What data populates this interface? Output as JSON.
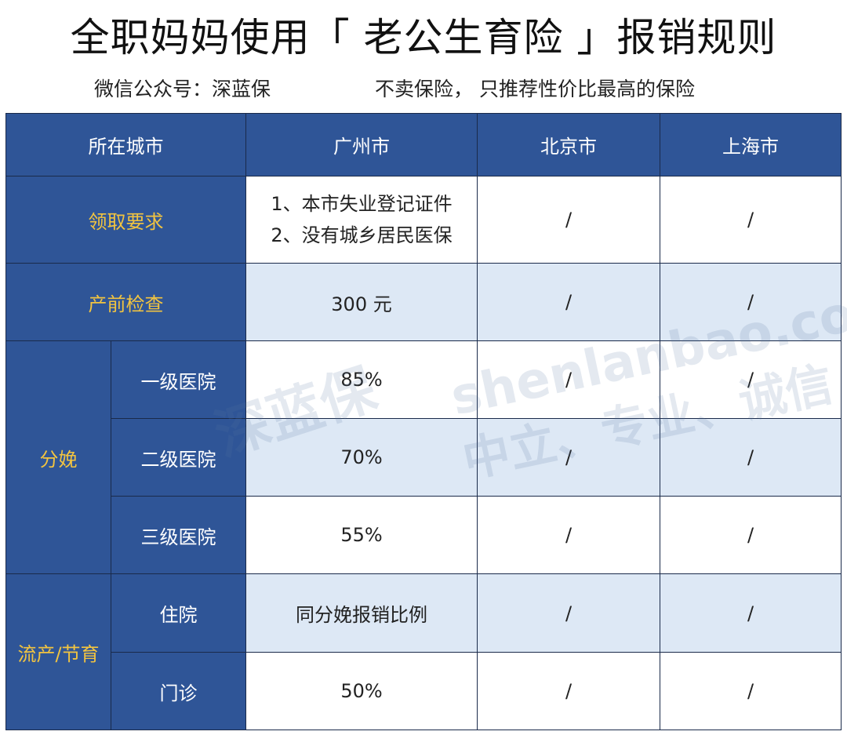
{
  "title": "全职妈妈使用「 老公生育险 」报销规则",
  "subtitle_left": "微信公众号：深蓝保",
  "subtitle_right": "不卖保险，  只推荐性价比最高的保险",
  "colors": {
    "header_bg": "#2f5597",
    "label_text": "#f2c440",
    "alt_row": "#dde8f5"
  },
  "watermark": {
    "url": "shenlanbao.com",
    "slogan": "中立、专业、诚信",
    "logo": "深蓝保"
  },
  "table": {
    "headers": [
      "所在城市",
      "广州市",
      "北京市",
      "上海市"
    ],
    "rows": {
      "requirement": {
        "label": "领取要求",
        "gz_line1": "1、本市失业登记证件",
        "gz_line2": "2、没有城乡居民医保",
        "bj": "/",
        "sh": "/"
      },
      "prenatal": {
        "label": "产前检查",
        "gz": "300 元",
        "bj": "/",
        "sh": "/"
      },
      "delivery": {
        "label": "分娩",
        "items": [
          {
            "sub": "一级医院",
            "gz": "85%",
            "bj": "/",
            "sh": "/"
          },
          {
            "sub": "二级医院",
            "gz": "70%",
            "bj": "/",
            "sh": "/"
          },
          {
            "sub": "三级医院",
            "gz": "55%",
            "bj": "/",
            "sh": "/"
          }
        ]
      },
      "abortion": {
        "label": "流产/节育",
        "items": [
          {
            "sub": "住院",
            "gz": "同分娩报销比例",
            "bj": "/",
            "sh": "/"
          },
          {
            "sub": "门诊",
            "gz": "50%",
            "bj": "/",
            "sh": "/"
          }
        ]
      }
    }
  }
}
